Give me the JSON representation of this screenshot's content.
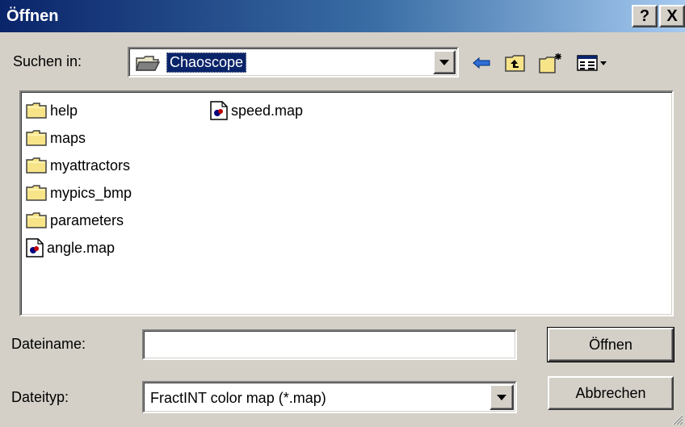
{
  "window": {
    "title": "Öffnen",
    "help_label": "?",
    "close_label": "X"
  },
  "lookin": {
    "label": "Suchen in:",
    "value": "Chaoscope"
  },
  "toolbar": {
    "icons": [
      "back-arrow-icon",
      "up-folder-icon",
      "new-folder-icon",
      "view-menu-icon"
    ]
  },
  "files": {
    "column1": [
      {
        "name": "help",
        "type": "folder"
      },
      {
        "name": "maps",
        "type": "folder"
      },
      {
        "name": "myattractors",
        "type": "folder"
      },
      {
        "name": "mypics_bmp",
        "type": "folder"
      },
      {
        "name": "parameters",
        "type": "folder"
      },
      {
        "name": "angle.map",
        "type": "map-file"
      }
    ],
    "column2": [
      {
        "name": "speed.map",
        "type": "map-file"
      }
    ]
  },
  "filename": {
    "label": "Dateiname:",
    "value": ""
  },
  "filetype": {
    "label": "Dateityp:",
    "value": "FractINT color map (*.map)"
  },
  "buttons": {
    "open": "Öffnen",
    "cancel": "Abbrechen"
  },
  "colors": {
    "title_start": "#0a246a",
    "title_end": "#a6caf0",
    "face": "#d4d0c8",
    "folder": "#f8e488"
  }
}
